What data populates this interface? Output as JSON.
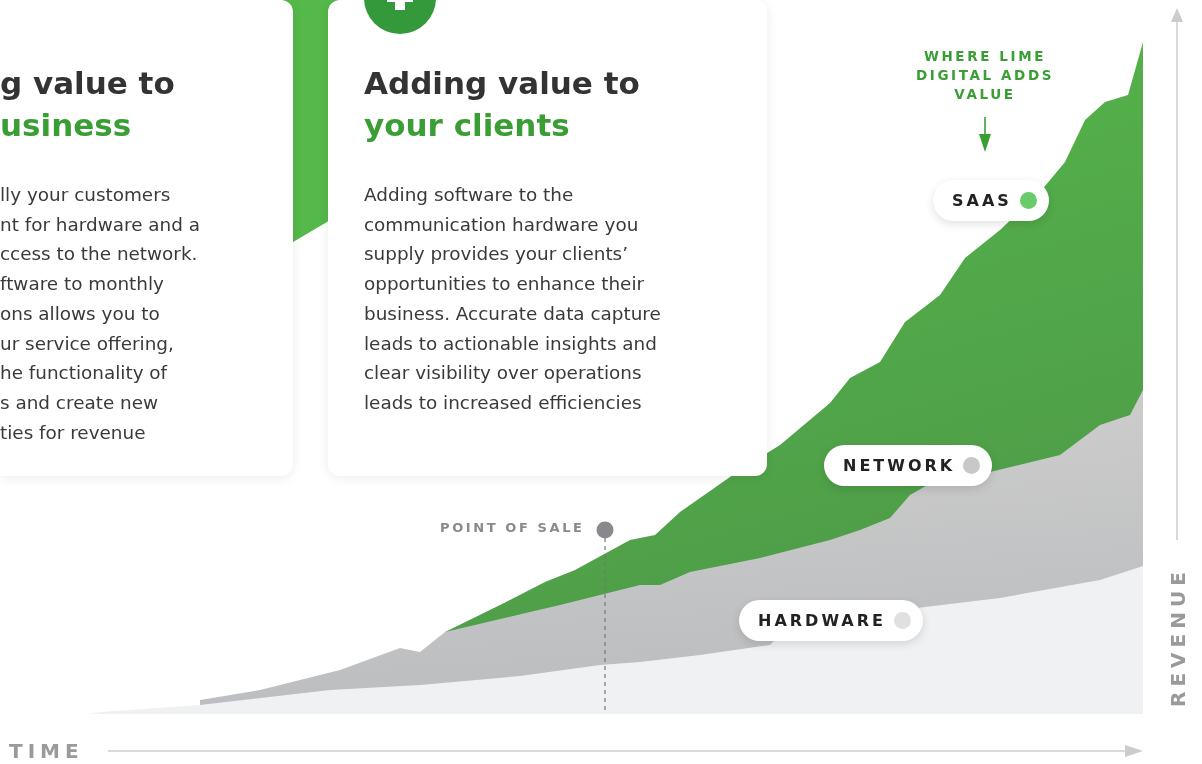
{
  "left_card": {
    "title_line1": "g value to",
    "title_line2": "usiness",
    "body_lines": [
      "lly your customers",
      "nt for hardware and a",
      "ccess to the network.",
      "ftware to monthly",
      "ons allows you to",
      "ur service offering,",
      "he functionality of",
      "s and create new",
      "ties for revenue"
    ]
  },
  "right_card": {
    "title_line1": "Adding value to",
    "title_line2": "your clients",
    "body": "Adding software to the communication hardware you supply provides your clients’ opportunities to enhance their business. Accurate data capture leads to actionable insights and clear visibility over operations leads to increased efficiencies"
  },
  "chart": {
    "callout": "WHERE LIME DIGITAL ADDS VALUE",
    "point_of_sale": "POINT OF SALE",
    "layers": [
      {
        "label": "SAAS",
        "color": "#6acb6a"
      },
      {
        "label": "NETWORK",
        "color": "#c8c8c8"
      },
      {
        "label": "HARDWARE",
        "color": "#e0e0e0"
      }
    ],
    "x_axis_label": "TIME",
    "y_axis_label": "REVENUE"
  }
}
